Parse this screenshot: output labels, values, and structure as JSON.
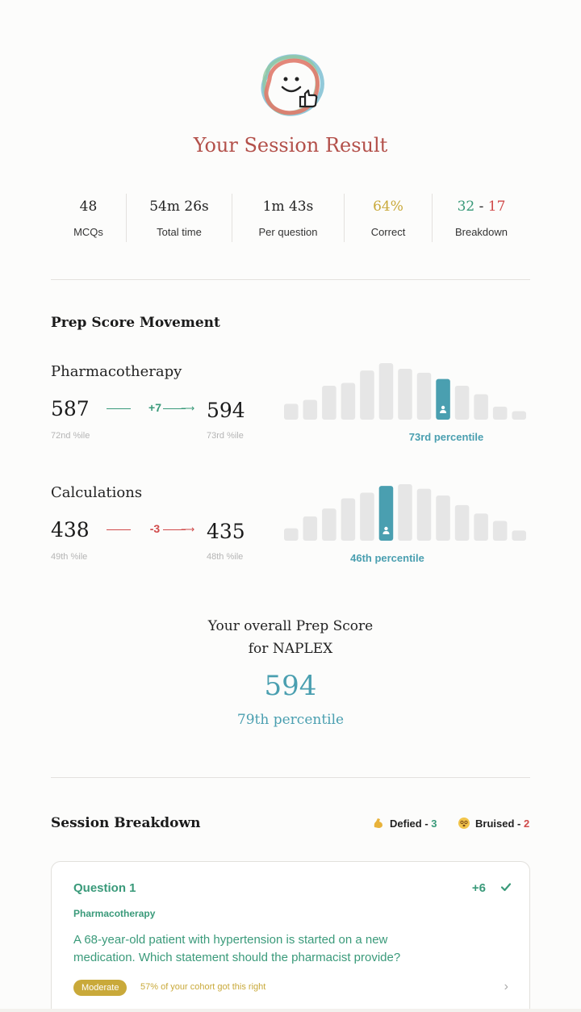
{
  "title": "Your Session Result",
  "stats": [
    {
      "value": "48",
      "label": "MCQs"
    },
    {
      "value": "54m 26s",
      "label": "Total time"
    },
    {
      "value": "1m 43s",
      "label": "Per question"
    },
    {
      "value": "64%",
      "label": "Correct"
    },
    {
      "value_correct": "32",
      "value_sep": " - ",
      "value_wrong": "17",
      "label": "Breakdown"
    }
  ],
  "prep": {
    "title": "Prep Score Movement",
    "subjects": [
      {
        "name": "Pharmacotherapy",
        "from": "587",
        "from_pct": "72nd %ile",
        "delta": "+7",
        "to": "594",
        "to_pct": "73rd %ile",
        "percentile_label": "73rd percentile",
        "distribution": [
          0.28,
          0.35,
          0.6,
          0.65,
          0.87,
          1.0,
          0.9,
          0.83,
          0.72,
          0.6,
          0.45,
          0.23,
          0.15
        ],
        "highlight_index": 8
      },
      {
        "name": "Calculations",
        "from": "438",
        "from_pct": "49th %ile",
        "delta": "-3",
        "to": "435",
        "to_pct": "48th %ile",
        "percentile_label": "46th percentile",
        "distribution": [
          0.22,
          0.43,
          0.57,
          0.75,
          0.85,
          0.97,
          1.0,
          0.92,
          0.8,
          0.63,
          0.48,
          0.35,
          0.18
        ],
        "highlight_index": 5
      }
    ]
  },
  "overall": {
    "label_line1": "Your overall Prep Score",
    "label_line2": "for NAPLEX",
    "score": "594",
    "percentile": "79th percentile"
  },
  "breakdown": {
    "title": "Session Breakdown",
    "defied_label": "Defied - ",
    "defied_count": "3",
    "bruised_label": "Bruised - ",
    "bruised_count": "2"
  },
  "question": {
    "title": "Question 1",
    "delta": "+6",
    "subject": "Pharmacotherapy",
    "text": "A 68-year-old patient with hypertension is started on a new medication. Which statement should the pharmacist provide?",
    "difficulty": "Moderate",
    "cohort": "57% of your cohort got this right"
  },
  "colors": {
    "accent_teal": "#4a9fb0",
    "green": "#3a9a7a",
    "red": "#d04a4a",
    "yellow": "#c9a93a",
    "title_red": "#b3504a",
    "bar_gray": "#e6e6e6"
  }
}
